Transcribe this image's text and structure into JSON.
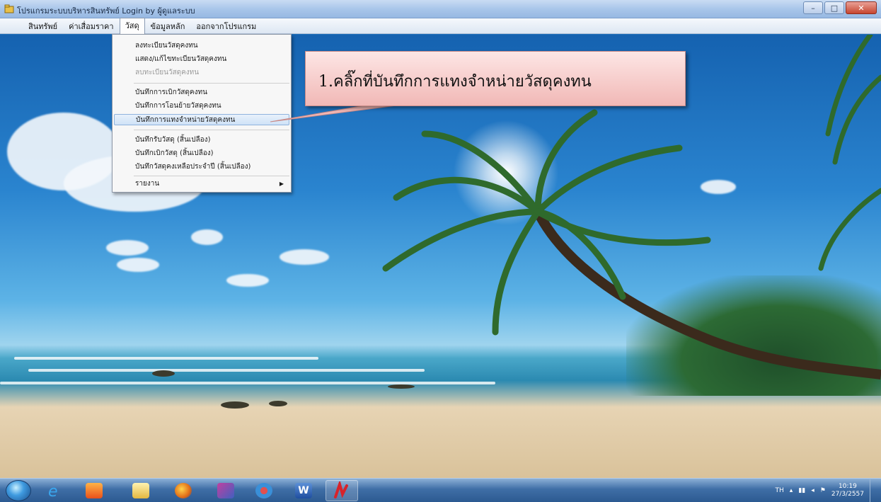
{
  "window": {
    "title": "โปรแกรมระบบบริหารสินทรัพย์   Login by  ผู้ดูแลระบบ"
  },
  "menubar": {
    "items": [
      "สินทรัพย์",
      "ค่าเสื่อมราคา",
      "วัสดุ",
      "ข้อมูลหลัก",
      "ออกจากโปรแกรม"
    ]
  },
  "dropdown": {
    "items": [
      {
        "label": "ลงทะเบียนวัสดุคงทน"
      },
      {
        "label": "แสดง/แก้ไขทะเบียนวัสดุคงทน"
      },
      {
        "label": "ลบทะเบียนวัสดุคงทน"
      },
      {
        "label": "บันทึกการเบิกวัสดุคงทน"
      },
      {
        "label": "บันทึกการโอนย้ายวัสดุคงทน"
      },
      {
        "label": "บันทึกการแทงจำหน่ายวัสดุคงทน"
      },
      {
        "label": "บันทึกรับวัสดุ (สิ้นเปลือง)"
      },
      {
        "label": "บันทึกเบิกวัสดุ (สิ้นเปลือง)"
      },
      {
        "label": "บันทึกวัสดุคงเหลือประจำปี (สิ้นเปลือง)"
      },
      {
        "label": "รายงาน"
      }
    ]
  },
  "callout": {
    "text": "1.คลิ๊กที่บันทึกการแทงจำหน่ายวัสดุคงทน"
  },
  "taskbar": {
    "apps": [
      "internet-explorer-icon",
      "media-player-icon",
      "file-explorer-icon",
      "firefox-icon",
      "messenger-icon",
      "sync-icon",
      "word-icon",
      "acrobat-icon"
    ],
    "tray": {
      "language": "TH",
      "time": "10:19",
      "date": "27/3/2557"
    }
  },
  "colors": {
    "callout_bg": "#f1b8b6",
    "menu_highlight": "#cfe2f7",
    "taskbar": "#2c5a91"
  }
}
